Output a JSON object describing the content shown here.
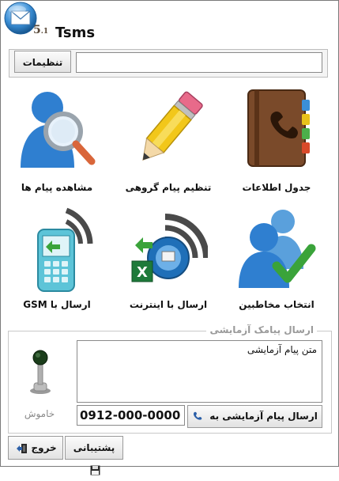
{
  "app": {
    "title": "Tsms",
    "logo_version": "5",
    "logo_version_small": ".1",
    "logo_icon": "envelope-icon"
  },
  "settings": {
    "button_label": "تنظیمات",
    "input_value": ""
  },
  "grid": [
    {
      "key": "contacts-table",
      "label": "جدول اطلاعات",
      "icon": "address-book-icon"
    },
    {
      "key": "group-message",
      "label": "تنظیم پیام گروهی",
      "icon": "pencil-icon"
    },
    {
      "key": "view-messages",
      "label": "مشاهده پیام ها",
      "icon": "user-search-icon"
    },
    {
      "key": "select-contacts",
      "label": "انتخاب مخاطبین",
      "icon": "users-check-icon"
    },
    {
      "key": "send-internet",
      "label": "ارسال با اینترنت",
      "icon": "globe-wireless-icon"
    },
    {
      "key": "send-gsm",
      "label": "ارسال با GSM",
      "icon": "mobile-phone-icon"
    }
  ],
  "test_sms": {
    "legend": "ارسال پیامک آزمایشی",
    "message_text": "متن پیام آزمایشی",
    "phone_number": "0912-000-0000",
    "send_button_label": "ارسال پیام آزمایشی به",
    "send_icon": "phone-handset-icon",
    "status_label": "خاموش",
    "status_icon": "joystick-indicator-icon",
    "status_color": "#1a3d1a"
  },
  "bottom": {
    "support_label": "پشتیبانی",
    "support_icon": "floppy-disk-icon",
    "exit_label": "خروج",
    "exit_icon": "exit-door-icon"
  }
}
